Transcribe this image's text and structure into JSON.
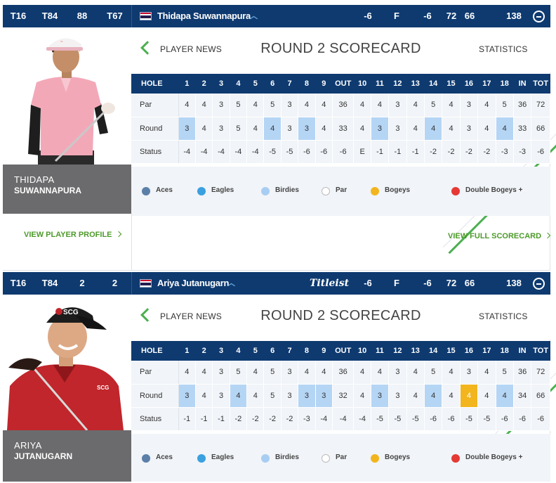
{
  "legend": {
    "aces": "Aces",
    "eagles": "Eagles",
    "birdies": "Birdies",
    "par": "Par",
    "bogeys": "Bogeys",
    "double": "Double Bogeys +",
    "colors": {
      "aces": "#5b7fa8",
      "eagles": "#3aa0e0",
      "birdies": "#a8cdf3",
      "par": "#ffffff",
      "bogeys": "#f2b51e",
      "double": "#e53935"
    }
  },
  "headers": [
    "HOLE",
    "1",
    "2",
    "3",
    "4",
    "5",
    "6",
    "7",
    "8",
    "9",
    "OUT",
    "10",
    "11",
    "12",
    "13",
    "14",
    "15",
    "16",
    "17",
    "18",
    "IN",
    "TOT"
  ],
  "players": [
    {
      "summary": [
        "T16",
        "T84",
        "88",
        "T67"
      ],
      "name": "Thidapa Suwannapura",
      "scores": [
        "-6",
        "F",
        "-6",
        "72",
        "66",
        "138"
      ],
      "first": "THIDAPA",
      "last": "SUWANNAPURA",
      "nav": {
        "news": "PLAYER NEWS",
        "title": "ROUND 2 SCORECARD",
        "stats": "STATISTICS"
      },
      "rows": [
        [
          "Par",
          "4",
          "4",
          "3",
          "5",
          "4",
          "5",
          "3",
          "4",
          "4",
          "36",
          "4",
          "4",
          "3",
          "4",
          "5",
          "4",
          "3",
          "4",
          "5",
          "36",
          "72"
        ],
        [
          "Round",
          "3",
          "4",
          "3",
          "5",
          "4",
          "4",
          "3",
          "3",
          "4",
          "33",
          "4",
          "3",
          "3",
          "4",
          "4",
          "4",
          "3",
          "4",
          "4",
          "33",
          "66"
        ],
        [
          "Status",
          "-4",
          "-4",
          "-4",
          "-4",
          "-4",
          "-5",
          "-5",
          "-6",
          "-6",
          "-6",
          "E",
          "-1",
          "-1",
          "-1",
          "-2",
          "-2",
          "-2",
          "-2",
          "-3",
          "-3",
          "-6"
        ]
      ],
      "profile_link": "VIEW PLAYER PROFILE",
      "full_link": "VIEW FULL SCORECARD"
    },
    {
      "summary": [
        "T16",
        "T84",
        "2",
        "2"
      ],
      "name": "Ariya Jutanugarn",
      "sponsor": "Titleist",
      "scores": [
        "-6",
        "F",
        "-6",
        "72",
        "66",
        "138"
      ],
      "first": "ARIYA",
      "last": "JUTANUGARN",
      "nav": {
        "news": "PLAYER NEWS",
        "title": "ROUND 2 SCORECARD",
        "stats": "STATISTICS"
      },
      "rows": [
        [
          "Par",
          "4",
          "4",
          "3",
          "5",
          "4",
          "5",
          "3",
          "4",
          "4",
          "36",
          "4",
          "4",
          "3",
          "4",
          "5",
          "4",
          "3",
          "4",
          "5",
          "36",
          "72"
        ],
        [
          "Round",
          "3",
          "4",
          "3",
          "4",
          "4",
          "5",
          "3",
          "3",
          "3",
          "32",
          "4",
          "3",
          "3",
          "4",
          "4",
          "4",
          "4",
          "4",
          "4",
          "34",
          "66"
        ],
        [
          "Status",
          "-1",
          "-1",
          "-1",
          "-2",
          "-2",
          "-2",
          "-2",
          "-3",
          "-4",
          "-4",
          "-4",
          "-5",
          "-5",
          "-5",
          "-6",
          "-6",
          "-5",
          "-5",
          "-6",
          "-6",
          "-6"
        ]
      ]
    }
  ]
}
